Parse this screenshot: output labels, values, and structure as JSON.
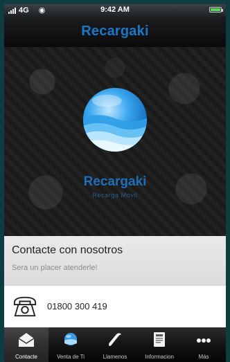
{
  "status_bar": {
    "carrier": "4G",
    "time": "9:42 AM"
  },
  "header": {
    "title": "Recargaki"
  },
  "hero": {
    "brand": "Recargaki",
    "tagline": "Recarga Móvil"
  },
  "contact": {
    "heading": "Contacte con nosotros",
    "subtitle": "Sera un placer atenderle!"
  },
  "phone": {
    "number": "01800 300 419"
  },
  "tabs": [
    {
      "label": "Contacte",
      "icon": "envelope-icon",
      "active": true
    },
    {
      "label": "Venta de Ti",
      "icon": "globe-icon",
      "active": false
    },
    {
      "label": "Llamenos",
      "icon": "phone-handset-icon",
      "active": false
    },
    {
      "label": "Informacion",
      "icon": "document-icon",
      "active": false
    },
    {
      "label": "Más",
      "icon": "more-icon",
      "active": false
    }
  ],
  "colors": {
    "accent_blue": "#1a78c8",
    "page_background": "#0f3d3f"
  }
}
